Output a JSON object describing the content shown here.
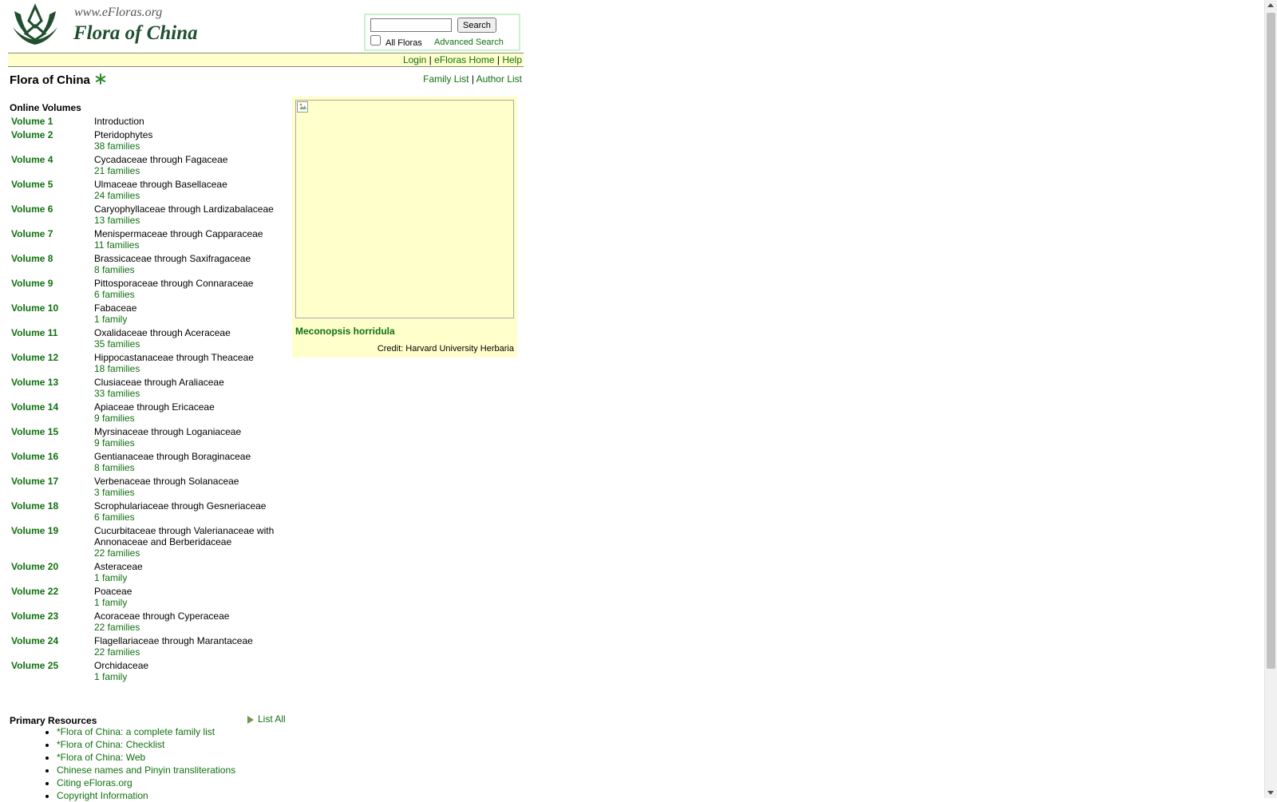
{
  "header": {
    "site_url": "www.eFloras.org",
    "site_title": "Flora of China",
    "search_button": "Search",
    "all_floras_label": "All Floras",
    "advanced_search": "Advanced Search"
  },
  "topbar": {
    "login": "Login",
    "home": "eFloras Home",
    "help": "Help",
    "separator": "|"
  },
  "title": {
    "text": "Flora of China",
    "family_list": "Family List",
    "author_list": "Author List"
  },
  "volumes": {
    "heading": "Online Volumes",
    "items": [
      {
        "name": "Volume 1",
        "desc": "Introduction",
        "families": ""
      },
      {
        "name": "Volume 2",
        "desc": "Pteridophytes",
        "families": "38 families"
      },
      {
        "name": "Volume 4",
        "desc": "Cycadaceae through Fagaceae",
        "families": "21 families"
      },
      {
        "name": "Volume 5",
        "desc": "Ulmaceae through Basellaceae",
        "families": "24 families"
      },
      {
        "name": "Volume 6",
        "desc": "Caryophyllaceae through Lardizabalaceae",
        "families": "13 families"
      },
      {
        "name": "Volume 7",
        "desc": "Menispermaceae through Capparaceae",
        "families": "11 families"
      },
      {
        "name": "Volume 8",
        "desc": "Brassicaceae through Saxifragaceae",
        "families": "8 families"
      },
      {
        "name": "Volume 9",
        "desc": "Pittosporaceae through Connaraceae",
        "families": "6 families"
      },
      {
        "name": "Volume 10",
        "desc": "Fabaceae",
        "families": "1 family"
      },
      {
        "name": "Volume 11",
        "desc": "Oxalidaceae through Aceraceae",
        "families": "35 families"
      },
      {
        "name": "Volume 12",
        "desc": "Hippocastanaceae through Theaceae",
        "families": "18 families"
      },
      {
        "name": "Volume 13",
        "desc": "Clusiaceae through Araliaceae",
        "families": "33 families"
      },
      {
        "name": "Volume 14",
        "desc": "Apiaceae through Ericaceae",
        "families": "9 families"
      },
      {
        "name": "Volume 15",
        "desc": "Myrsinaceae through Loganiaceae",
        "families": "9 families"
      },
      {
        "name": "Volume 16",
        "desc": "Gentianaceae through Boraginaceae",
        "families": "8 families"
      },
      {
        "name": "Volume 17",
        "desc": "Verbenaceae through Solanaceae",
        "families": "3 families"
      },
      {
        "name": "Volume 18",
        "desc": "Scrophulariaceae through Gesneriaceae",
        "families": "6 families"
      },
      {
        "name": "Volume 19",
        "desc": "Cucurbitaceae through Valerianaceae with Annonaceae and Berberidaceae",
        "families": "22 families"
      },
      {
        "name": "Volume 20",
        "desc": "Asteraceae",
        "families": "1 family"
      },
      {
        "name": "Volume 22",
        "desc": "Poaceae",
        "families": "1 family"
      },
      {
        "name": "Volume 23",
        "desc": "Acoraceae through Cyperaceae",
        "families": "22 families"
      },
      {
        "name": "Volume 24",
        "desc": "Flagellariaceae through Marantaceae",
        "families": "22 families"
      },
      {
        "name": "Volume 25",
        "desc": "Orchidaceae",
        "families": "1 family"
      }
    ]
  },
  "image_panel": {
    "caption": "Meconopsis horridula",
    "credit": "Credit: Harvard University Herbaria"
  },
  "resources": {
    "heading": "Primary Resources",
    "list_all": "List All",
    "items": [
      "*Flora of China: a complete family list",
      "*Flora of China: Checklist",
      "*Flora of China: Web",
      "Chinese names and Pinyin transliterations",
      "Citing eFloras.org",
      "Copyright Information"
    ]
  },
  "colors": {
    "link": "#107010",
    "bar_background": "#ffffcc",
    "title_green": "#1f4f2f"
  }
}
